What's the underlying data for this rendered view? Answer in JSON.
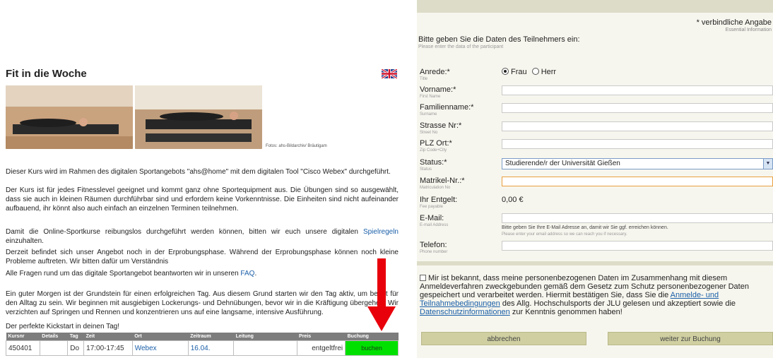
{
  "course": {
    "title": "Fit in die Woche",
    "photo_credit": "Fotos: ahs-Bildarchiv/ Bräutigam",
    "paragraphs": [
      "Dieser Kurs wird im Rahmen des digitalen Sportangebots \"ahs@home\" mit dem digitalen Tool \"Cisco Webex\" durchgeführt.",
      "Der Kurs ist für jedes Fitnesslevel geeignet und kommt ganz ohne Sportequipment aus. Die Übungen sind so ausgewählt, dass sie auch in kleinen Räumen durchführbar sind und erfordern keine Vorkenntnisse. Die Einheiten sind nicht aufeinander aufbauend, ihr könnt also auch einfach an einzelnen Terminen teilnehmen."
    ],
    "p3_text": "Damit die Online-Sportkurse reibungslos durchgeführt werden können, bitten wir euch unsere digitalen ",
    "p3_link": "Spielregeln",
    "p3_end": " einzuhalten.",
    "p4": "Derzeit befindet sich unser Angebot noch in der Erprobungsphase. Während der Erprobungsphase können noch kleine Probleme auftreten. Wir bitten dafür um Verständnis",
    "p5_text": "Alle Fragen rund um das digitale Sportangebot beantworten wir in unseren ",
    "p5_link": "FAQ",
    "p5_end": ".",
    "p6": "Ein guter Morgen ist der Grundstein für einen erfolgreichen Tag. Aus diesem Grund starten wir den Tag aktiv, um bereit für den Alltag zu sein. Wir beginnen mit ausgiebigen Lockerungs- und Dehnübungen, bevor wir in die Kräftigung übergehen. Wir verzichten auf Springen und Rennen und konzentrieren uns auf eine langsame, intensive Ausführung.",
    "p7": "Der perfekte Kickstart in deinen Tag!",
    "table_headers": [
      "Kursnr",
      "Details",
      "Tag",
      "Zeit",
      "Ort",
      "Zeitraum",
      "Leitung",
      "Preis",
      "Buchung"
    ],
    "row": {
      "kursnr": "450401",
      "details": "",
      "tag": "Do",
      "zeit": "17:00-17:45",
      "ort": "Webex",
      "zeitraum": "16.04.",
      "leitung": "",
      "preis": "entgeltfrei",
      "buchung": "buchen"
    }
  },
  "form": {
    "required_note": "* verbindliche Angabe",
    "required_note_en": "Essential Information",
    "intro": "Bitte geben Sie die Daten des Teilnehmers ein:",
    "intro_en": "Please enter the data of the participant",
    "anrede_label": "Anrede:*",
    "anrede_sub": "Title",
    "opt_frau": "Frau",
    "opt_herr": "Herr",
    "vorname_label": "Vorname:*",
    "vorname_sub": "First Name",
    "familienname_label": "Familienname:*",
    "familienname_sub": "Surname",
    "strasse_label": "Strasse Nr:*",
    "strasse_sub": "Street No",
    "plz_label": "PLZ Ort:*",
    "plz_sub": "Zip Code+City",
    "status_label": "Status:*",
    "status_sub": "Status",
    "status_value": "Studierende/r der Universität Gießen",
    "matrikel_label": "Matrikel-Nr.:*",
    "matrikel_sub": "Matriculation No",
    "entgelt_label": "Ihr Entgelt:",
    "entgelt_sub": "Fee payable",
    "entgelt_value": "0,00 €",
    "email_label": "E-Mail:",
    "email_sub": "E-mail Address",
    "email_hint": "Bitte geben Sie Ihre E-Mail Adresse an, damit wir Sie ggf. erreichen können.",
    "email_hint_en": "Please enter your email address so we can reach you if necessary.",
    "telefon_label": "Telefon:",
    "telefon_sub": "Phone number",
    "consent_1": "Mir ist bekannt, dass meine personenbezogenen Daten im Zusammenhang mit diesem Anmeldeverfahren zweckgebunden gemäß dem Gesetz zum Schutz personenbezogener Daten gespeichert und verarbeitet werden. Hiermit bestätigen Sie, dass Sie die ",
    "consent_link1": "Anmelde- und Teilnahmebedingungen",
    "consent_2": " des Allg. Hochschulsports der JLU gelesen und akzeptiert sowie die ",
    "consent_link2": "Datenschutzinformationen",
    "consent_3": " zur Kenntnis genommen haben!",
    "btn_cancel": "abbrechen",
    "btn_next": "weiter zur Buchung"
  },
  "colors": {
    "book_green": "#00e000",
    "arrow_red": "#e8000b",
    "link_blue": "#1a5fa8"
  },
  "icons": {
    "flag": "uk-flag-icon",
    "arrow": "down-arrow-icon"
  }
}
